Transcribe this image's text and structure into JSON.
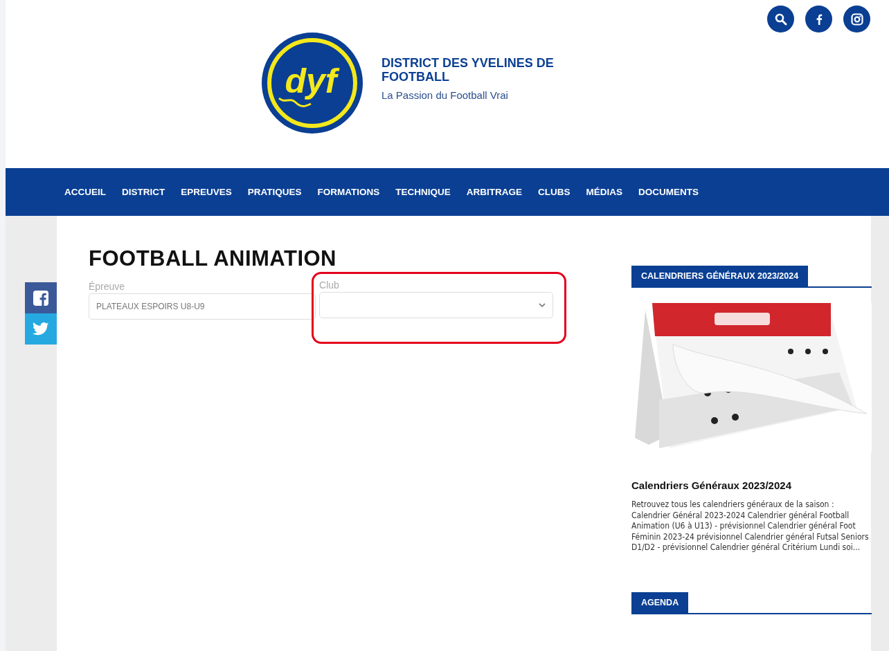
{
  "header": {
    "title": "DISTRICT DES YVELINES DE FOOTBALL",
    "tagline": "La Passion du Football Vrai",
    "logo_text": "dyf"
  },
  "nav": {
    "items": [
      {
        "label": "ACCUEIL"
      },
      {
        "label": "DISTRICT"
      },
      {
        "label": "EPREUVES"
      },
      {
        "label": "PRATIQUES"
      },
      {
        "label": "FORMATIONS"
      },
      {
        "label": "TECHNIQUE"
      },
      {
        "label": "ARBITRAGE"
      },
      {
        "label": "CLUBS"
      },
      {
        "label": "MÉDIAS"
      },
      {
        "label": "DOCUMENTS"
      }
    ]
  },
  "page": {
    "title": "FOOTBALL ANIMATION",
    "filters": [
      {
        "label": "Épreuve",
        "kind": "text",
        "value": "PLATEAUX ESPOIRS U8-U9",
        "highlighted": false
      },
      {
        "label": "Club",
        "kind": "select",
        "highlighted": true
      }
    ]
  },
  "sidebar": {
    "sections": [
      {
        "heading": "CALENDRIERS GÉNÉRAUX 2023/2024",
        "article": {
          "title": "Calendriers Généraux 2023/2024",
          "excerpt": "Retrouvez tous les calendriers généraux de la saison :  Calendrier Général 2023-2024 Calendrier général Football Animation (U6 à U13) - prévisionnel Calendrier général Foot Féminin 2023-24 prévisionnel Calendrier général Futsal Seniors D1/D2 - prévisionnel Calendrier général Critérium Lundi soi..."
        }
      },
      {
        "heading": "AGENDA"
      }
    ]
  }
}
